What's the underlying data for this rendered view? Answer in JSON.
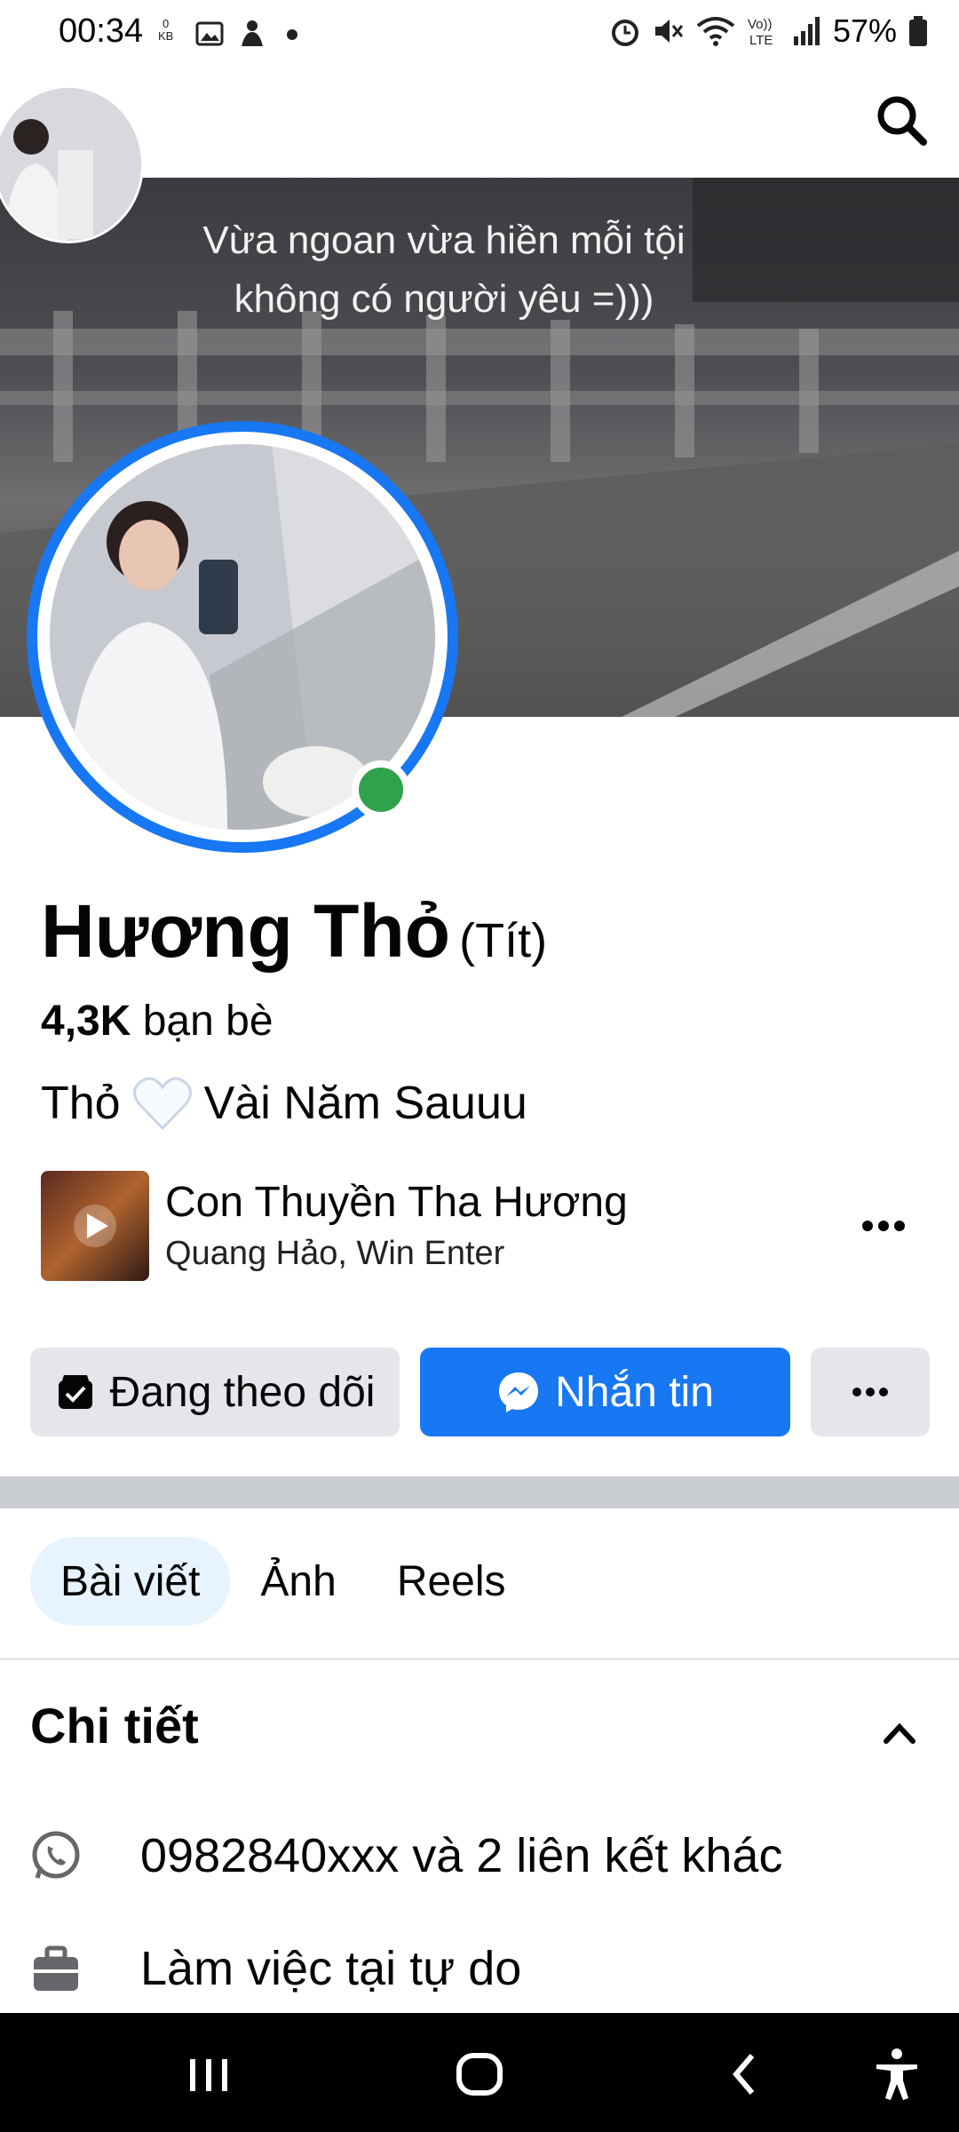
{
  "status_bar": {
    "time": "00:34",
    "kb_value": "0",
    "kb_unit": "KB",
    "battery": "57%",
    "icons": [
      "gallery-icon",
      "notification-icon",
      "dot-icon",
      "alarm-icon",
      "mute-icon",
      "wifi-icon",
      "volte-icon",
      "signal-icon",
      "battery-icon"
    ]
  },
  "cover": {
    "caption_line1": "Vừa ngoan vừa hiền mỗi tội",
    "caption_line2": "không có người yêu =)))"
  },
  "profile": {
    "name": "Hương Thỏ",
    "nickname": "(Tít)",
    "friends_count": "4,3K",
    "friends_label": "bạn bè",
    "bio_part1": "Thỏ",
    "bio_part2": "Vài Năm Sauuu",
    "online": true
  },
  "music": {
    "title": "Con Thuyền Tha Hương",
    "artist": "Quang Hảo, Win Enter"
  },
  "actions": {
    "follow_label": "Đang theo dõi",
    "message_label": "Nhắn tin"
  },
  "tabs": [
    {
      "label": "Bài viết",
      "active": true
    },
    {
      "label": "Ảnh",
      "active": false
    },
    {
      "label": "Reels",
      "active": false
    }
  ],
  "details": {
    "title": "Chi tiết",
    "phone_text": "0982840xxx và 2 liên kết khác",
    "work_text": "Làm việc tại tự do"
  },
  "colors": {
    "accent": "#1877f2",
    "online": "#31a24c",
    "tab_active_bg": "#e7f3ff"
  }
}
